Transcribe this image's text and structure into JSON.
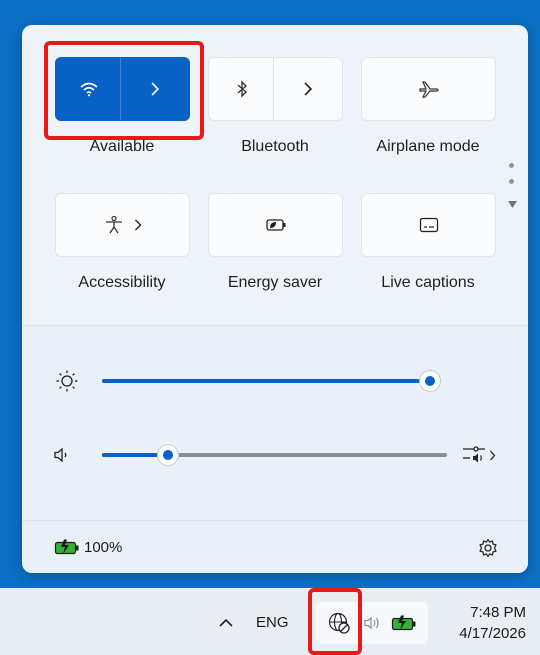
{
  "quick_settings": {
    "tiles": [
      {
        "label": "Available",
        "icon": "wifi-icon",
        "active": true
      },
      {
        "label": "Bluetooth",
        "icon": "bluetooth-icon",
        "active": false
      },
      {
        "label": "Airplane mode",
        "icon": "airplane-icon",
        "active": false
      },
      {
        "label": "Accessibility",
        "icon": "accessibility-icon",
        "active": false
      },
      {
        "label": "Energy saver",
        "icon": "energy-saver-icon",
        "active": false
      },
      {
        "label": "Live captions",
        "icon": "live-captions-icon",
        "active": false
      }
    ],
    "chevron": "›",
    "brightness": {
      "level": 0.99,
      "icon": "brightness-icon"
    },
    "volume": {
      "level": 0.19,
      "icon": "speaker-icon"
    },
    "battery_percent": "100%",
    "accent_color": "#0861c4"
  },
  "taskbar": {
    "language": "ENG",
    "time": "7:48 PM",
    "date": "4/17/2026",
    "overflow_chevron": "^"
  }
}
